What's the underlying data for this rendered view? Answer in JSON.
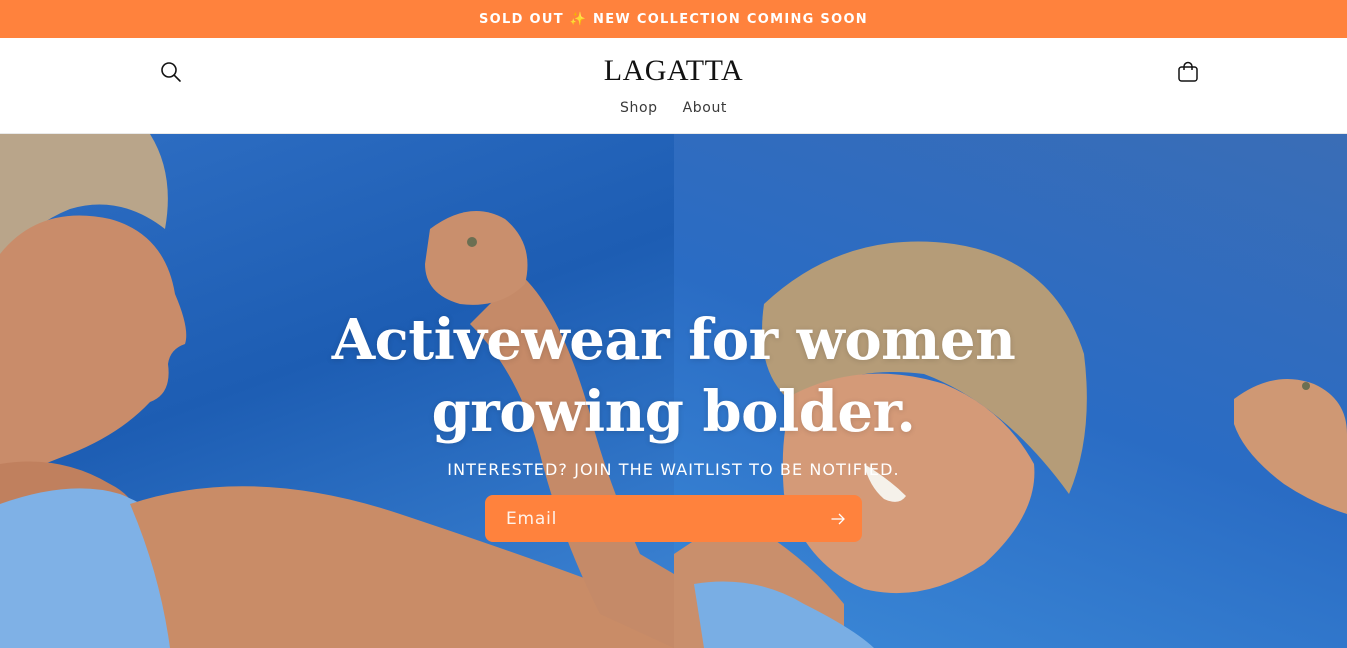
{
  "announcement": {
    "text": "SOLD OUT ✨ NEW COLLECTION COMING SOON"
  },
  "header": {
    "logo": "LAGATTA",
    "search_icon": "search-icon",
    "cart_icon": "cart-icon",
    "nav": [
      {
        "label": "Shop"
      },
      {
        "label": "About"
      }
    ]
  },
  "hero": {
    "title": "Activewear for women growing bolder.",
    "subtitle": "INTERESTED? JOIN THE WAITLIST TO BE NOTIFIED.",
    "email_placeholder": "Email",
    "submit_icon": "arrow-right-icon"
  },
  "colors": {
    "accent": "#ff823d",
    "sky_blue": "#2a6cc4",
    "text": "#121212"
  }
}
